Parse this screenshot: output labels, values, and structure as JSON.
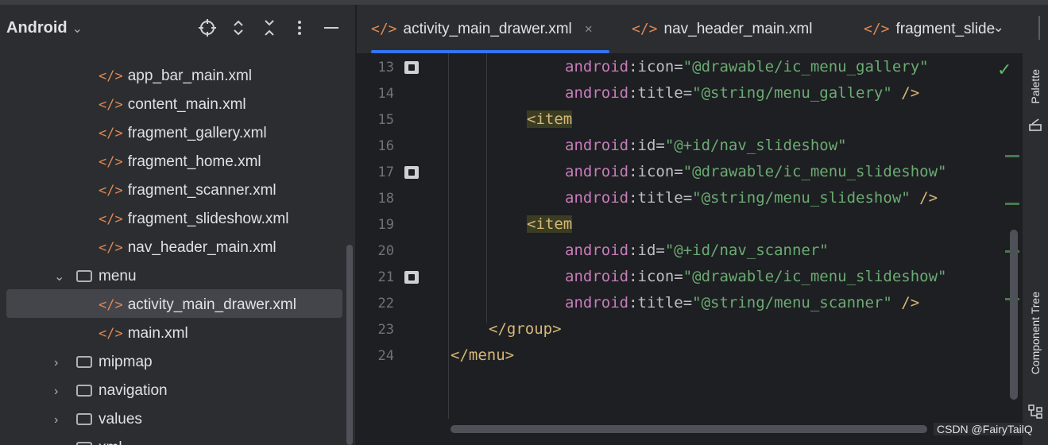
{
  "project_panel": {
    "title": "Android",
    "title_chevron": "⌄",
    "header_icons": [
      "locate-icon",
      "expand-collapse-icon",
      "collapse-all-icon",
      "more-icon",
      "minimize-icon"
    ],
    "tree": [
      {
        "label": "app_bar_main.xml",
        "type": "file"
      },
      {
        "label": "content_main.xml",
        "type": "file"
      },
      {
        "label": "fragment_gallery.xml",
        "type": "file"
      },
      {
        "label": "fragment_home.xml",
        "type": "file"
      },
      {
        "label": "fragment_scanner.xml",
        "type": "file"
      },
      {
        "label": "fragment_slideshow.xml",
        "type": "file"
      },
      {
        "label": "nav_header_main.xml",
        "type": "file"
      },
      {
        "label": "menu",
        "type": "folder",
        "expanded": true
      },
      {
        "label": "activity_main_drawer.xml",
        "type": "file",
        "selected": true
      },
      {
        "label": "main.xml",
        "type": "file"
      },
      {
        "label": "mipmap",
        "type": "folder",
        "expanded": false
      },
      {
        "label": "navigation",
        "type": "folder",
        "expanded": false
      },
      {
        "label": "values",
        "type": "folder",
        "expanded": false
      },
      {
        "label": "xml",
        "type": "folder",
        "expanded": false
      }
    ]
  },
  "editor_tabs": {
    "xml_glyph": "</>",
    "tabs": [
      {
        "label": "activity_main_drawer.xml",
        "active": true,
        "close": "×"
      },
      {
        "label": "nav_header_main.xml",
        "active": false
      },
      {
        "label": "fragment_slide",
        "active": false
      }
    ],
    "more": "⌄",
    "status_check": "✓"
  },
  "code": {
    "lines": [
      {
        "num": "13",
        "ns": "android",
        "attr": ":icon=",
        "val": "\"@drawable/ic_menu_gallery\"",
        "end": "",
        "gutter": "image-icon"
      },
      {
        "num": "14",
        "ns": "android",
        "attr": ":title=",
        "val": "\"@string/menu_gallery\"",
        "end": " />",
        "gutter": ""
      },
      {
        "num": "15",
        "tag": "<item",
        "gutter": ""
      },
      {
        "num": "16",
        "ns": "android",
        "attr": ":id=",
        "val": "\"@+id/nav_slideshow\"",
        "end": "",
        "gutter": ""
      },
      {
        "num": "17",
        "ns": "android",
        "attr": ":icon=",
        "val": "\"@drawable/ic_menu_slideshow\"",
        "end": "",
        "gutter": "image-icon"
      },
      {
        "num": "18",
        "ns": "android",
        "attr": ":title=",
        "val": "\"@string/menu_slideshow\"",
        "end": " />",
        "gutter": ""
      },
      {
        "num": "19",
        "tag": "<item",
        "gutter": ""
      },
      {
        "num": "20",
        "ns": "android",
        "attr": ":id=",
        "val": "\"@+id/nav_scanner\"",
        "end": "",
        "gutter": ""
      },
      {
        "num": "21",
        "ns": "android",
        "attr": ":icon=",
        "val": "\"@drawable/ic_menu_slideshow\"",
        "end": "",
        "gutter": "image-icon"
      },
      {
        "num": "22",
        "ns": "android",
        "attr": ":title=",
        "val": "\"@string/menu_scanner\"",
        "end": " />",
        "gutter": ""
      },
      {
        "num": "23",
        "close": "</group>",
        "gutter": ""
      },
      {
        "num": "24",
        "close": "</menu>",
        "gutter": ""
      }
    ]
  },
  "right_strip": {
    "palette_label": "Palette",
    "component_tree_label": "Component Tree"
  },
  "watermark": "CSDN @FairyTailQ",
  "colors": {
    "accent": "#3574f0",
    "xml_icon": "#e08855",
    "string": "#6aab73",
    "namespace": "#c77dbb",
    "tag": "#d5b778"
  }
}
